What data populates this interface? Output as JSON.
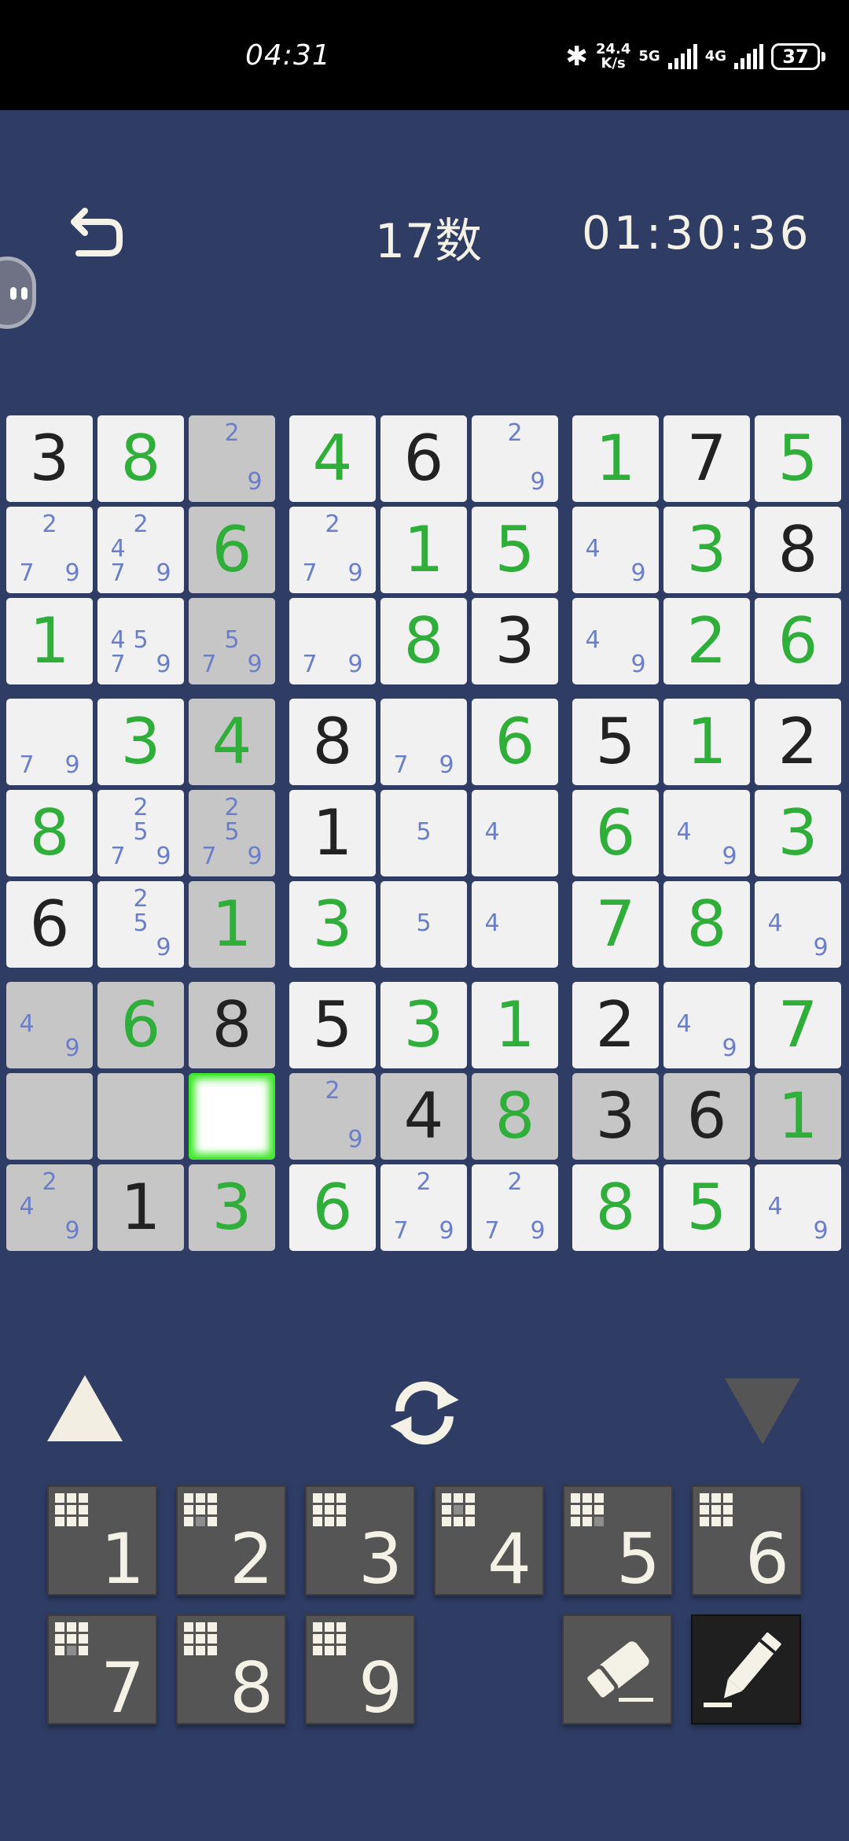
{
  "status_bar": {
    "time": "04:31",
    "speed_value": "24.4",
    "speed_unit": "K/s",
    "net1": "5G",
    "net2": "4G",
    "battery": "37"
  },
  "header": {
    "title": "17数",
    "timer": "01:30:36"
  },
  "board": {
    "selected": [
      7,
      2
    ],
    "cells": [
      [
        {
          "v": "3",
          "t": "g"
        },
        {
          "v": "8",
          "t": "u"
        },
        {
          "n": [
            2,
            9
          ],
          "bg": "gray"
        },
        {
          "v": "4",
          "t": "u"
        },
        {
          "v": "6",
          "t": "g"
        },
        {
          "n": [
            2,
            9
          ]
        },
        {
          "v": "1",
          "t": "u"
        },
        {
          "v": "7",
          "t": "g"
        },
        {
          "v": "5",
          "t": "u"
        }
      ],
      [
        {
          "n": [
            2,
            7,
            9
          ]
        },
        {
          "n": [
            2,
            4,
            7,
            9
          ]
        },
        {
          "v": "6",
          "t": "u",
          "bg": "gray"
        },
        {
          "n": [
            2,
            7,
            9
          ]
        },
        {
          "v": "1",
          "t": "u"
        },
        {
          "v": "5",
          "t": "u"
        },
        {
          "n": [
            4,
            9
          ]
        },
        {
          "v": "3",
          "t": "u"
        },
        {
          "v": "8",
          "t": "g"
        }
      ],
      [
        {
          "v": "1",
          "t": "u"
        },
        {
          "n": [
            4,
            5,
            7,
            9
          ]
        },
        {
          "n": [
            5,
            7,
            9
          ],
          "bg": "gray"
        },
        {
          "n": [
            7,
            9
          ]
        },
        {
          "v": "8",
          "t": "u"
        },
        {
          "v": "3",
          "t": "g"
        },
        {
          "n": [
            4,
            9
          ]
        },
        {
          "v": "2",
          "t": "u"
        },
        {
          "v": "6",
          "t": "u"
        }
      ],
      [
        {
          "n": [
            7,
            9
          ]
        },
        {
          "v": "3",
          "t": "u"
        },
        {
          "v": "4",
          "t": "u",
          "bg": "gray"
        },
        {
          "v": "8",
          "t": "g"
        },
        {
          "n": [
            7,
            9
          ]
        },
        {
          "v": "6",
          "t": "u"
        },
        {
          "v": "5",
          "t": "g"
        },
        {
          "v": "1",
          "t": "u"
        },
        {
          "v": "2",
          "t": "g"
        }
      ],
      [
        {
          "v": "8",
          "t": "u"
        },
        {
          "n": [
            2,
            5,
            7,
            9
          ]
        },
        {
          "n": [
            2,
            5,
            7,
            9
          ],
          "bg": "gray"
        },
        {
          "v": "1",
          "t": "g"
        },
        {
          "n": [
            5
          ]
        },
        {
          "n": [
            4
          ]
        },
        {
          "v": "6",
          "t": "u"
        },
        {
          "n": [
            4,
            9
          ]
        },
        {
          "v": "3",
          "t": "u"
        }
      ],
      [
        {
          "v": "6",
          "t": "g"
        },
        {
          "n": [
            2,
            5,
            9
          ]
        },
        {
          "v": "1",
          "t": "u",
          "bg": "gray"
        },
        {
          "v": "3",
          "t": "u"
        },
        {
          "n": [
            5
          ]
        },
        {
          "n": [
            4
          ]
        },
        {
          "v": "7",
          "t": "u"
        },
        {
          "v": "8",
          "t": "u"
        },
        {
          "n": [
            4,
            9
          ]
        }
      ],
      [
        {
          "n": [
            4,
            9
          ],
          "bg": "gray"
        },
        {
          "v": "6",
          "t": "u",
          "bg": "gray"
        },
        {
          "v": "8",
          "t": "g",
          "bg": "gray"
        },
        {
          "v": "5",
          "t": "g"
        },
        {
          "v": "3",
          "t": "u"
        },
        {
          "v": "1",
          "t": "u"
        },
        {
          "v": "2",
          "t": "g"
        },
        {
          "n": [
            4,
            9
          ]
        },
        {
          "v": "7",
          "t": "u"
        }
      ],
      [
        {
          "n": [],
          "bg": "gray"
        },
        {
          "n": [],
          "bg": "gray"
        },
        {
          "n": [],
          "bg": "sel"
        },
        {
          "n": [
            2,
            9
          ],
          "bg": "gray"
        },
        {
          "v": "4",
          "t": "g",
          "bg": "gray"
        },
        {
          "v": "8",
          "t": "u",
          "bg": "gray"
        },
        {
          "v": "3",
          "t": "g",
          "bg": "gray"
        },
        {
          "v": "6",
          "t": "g",
          "bg": "gray"
        },
        {
          "v": "1",
          "t": "u",
          "bg": "gray"
        }
      ],
      [
        {
          "n": [
            2,
            4,
            9
          ],
          "bg": "gray"
        },
        {
          "v": "1",
          "t": "g",
          "bg": "gray"
        },
        {
          "v": "3",
          "t": "u",
          "bg": "gray"
        },
        {
          "v": "6",
          "t": "u"
        },
        {
          "n": [
            2,
            7,
            9
          ]
        },
        {
          "n": [
            2,
            7,
            9
          ]
        },
        {
          "v": "8",
          "t": "u"
        },
        {
          "v": "5",
          "t": "u"
        },
        {
          "n": [
            4,
            9
          ]
        }
      ]
    ]
  },
  "keypad": [
    {
      "label": "1",
      "mini": [
        1,
        1,
        1,
        1,
        1,
        1,
        1,
        1,
        1
      ]
    },
    {
      "label": "2",
      "mini": [
        1,
        1,
        1,
        1,
        1,
        1,
        1,
        0,
        1
      ]
    },
    {
      "label": "3",
      "mini": [
        1,
        1,
        1,
        1,
        1,
        1,
        1,
        1,
        1
      ]
    },
    {
      "label": "4",
      "mini": [
        1,
        1,
        1,
        1,
        0,
        1,
        1,
        1,
        1
      ]
    },
    {
      "label": "5",
      "mini": [
        1,
        1,
        1,
        1,
        1,
        1,
        1,
        1,
        0
      ]
    },
    {
      "label": "6",
      "mini": [
        1,
        1,
        1,
        1,
        1,
        1,
        1,
        1,
        1
      ]
    },
    {
      "label": "7",
      "mini": [
        1,
        1,
        1,
        1,
        1,
        1,
        1,
        0,
        1
      ]
    },
    {
      "label": "8",
      "mini": [
        1,
        1,
        1,
        1,
        1,
        1,
        1,
        1,
        1
      ]
    },
    {
      "label": "9",
      "mini": [
        1,
        1,
        1,
        1,
        1,
        1,
        1,
        1,
        1
      ]
    }
  ],
  "icons": {
    "back": "back-arrow-icon",
    "up": "previous-triangle-icon",
    "down": "next-triangle-icon",
    "refresh": "refresh-icon",
    "eraser": "eraser-icon",
    "pencil": "pencil-icon"
  },
  "colors": {
    "background": "#2f3c64",
    "given": "#222222",
    "user": "#2fae3a",
    "note": "#6a7fc8",
    "select": "#42e82f"
  }
}
